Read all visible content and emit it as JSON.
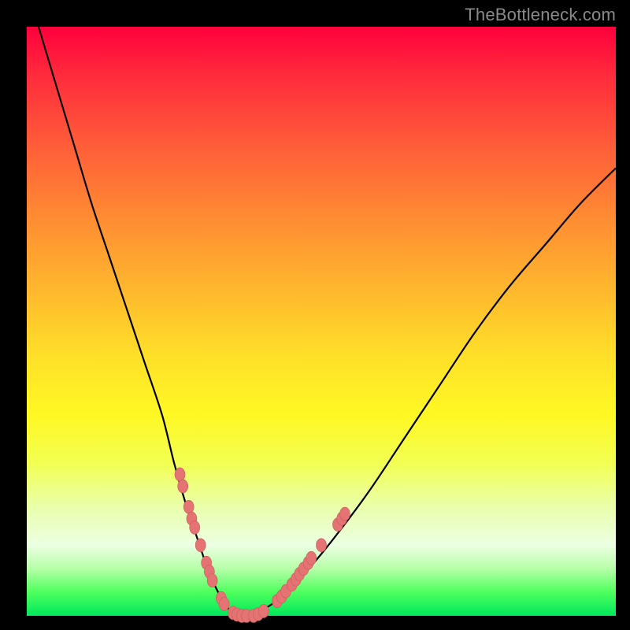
{
  "watermark": "TheBottleneck.com",
  "colors": {
    "background_frame": "#000000",
    "gradient_top": "#ff003c",
    "gradient_mid": "#ffe029",
    "gradient_bottom": "#00e85d",
    "curve_stroke": "#000000",
    "marker_fill": "#e57373",
    "marker_stroke": "#c45b5b"
  },
  "chart_data": {
    "type": "line",
    "title": "",
    "xlabel": "",
    "ylabel": "",
    "xlim": [
      0,
      100
    ],
    "ylim": [
      0,
      100
    ],
    "grid": false,
    "series": [
      {
        "name": "bottleneck-curve",
        "x": [
          2,
          5,
          8,
          11,
          14,
          17,
          20,
          23,
          25,
          27,
          29,
          30,
          31,
          32,
          33,
          34,
          35,
          36,
          38,
          40,
          43,
          47,
          52,
          58,
          64,
          70,
          76,
          82,
          88,
          94,
          100
        ],
        "values": [
          100,
          90,
          80,
          70,
          61,
          52,
          43,
          34,
          26,
          19,
          13,
          10,
          7,
          5,
          3,
          1.5,
          0.5,
          0,
          0,
          1,
          3,
          7,
          13,
          21,
          30,
          39,
          48,
          56,
          63,
          70,
          76
        ]
      }
    ],
    "markers": [
      {
        "x": 26.0,
        "y": 24.0
      },
      {
        "x": 26.5,
        "y": 22.0
      },
      {
        "x": 27.5,
        "y": 18.5
      },
      {
        "x": 28.0,
        "y": 16.5
      },
      {
        "x": 28.5,
        "y": 15.0
      },
      {
        "x": 29.5,
        "y": 12.0
      },
      {
        "x": 30.5,
        "y": 9.0
      },
      {
        "x": 31.0,
        "y": 7.5
      },
      {
        "x": 31.5,
        "y": 6.0
      },
      {
        "x": 33.0,
        "y": 3.0
      },
      {
        "x": 33.5,
        "y": 2.0
      },
      {
        "x": 35.0,
        "y": 0.5
      },
      {
        "x": 35.7,
        "y": 0.2
      },
      {
        "x": 36.5,
        "y": 0.0
      },
      {
        "x": 37.3,
        "y": 0.0
      },
      {
        "x": 38.5,
        "y": 0.0
      },
      {
        "x": 39.3,
        "y": 0.3
      },
      {
        "x": 40.2,
        "y": 0.8
      },
      {
        "x": 42.5,
        "y": 2.5
      },
      {
        "x": 43.3,
        "y": 3.3
      },
      {
        "x": 44.0,
        "y": 4.2
      },
      {
        "x": 45.0,
        "y": 5.3
      },
      {
        "x": 45.7,
        "y": 6.2
      },
      {
        "x": 46.3,
        "y": 7.1
      },
      {
        "x": 47.0,
        "y": 8.0
      },
      {
        "x": 47.8,
        "y": 9.0
      },
      {
        "x": 48.3,
        "y": 9.8
      },
      {
        "x": 50.0,
        "y": 12.0
      },
      {
        "x": 52.8,
        "y": 15.5
      },
      {
        "x": 53.5,
        "y": 16.5
      },
      {
        "x": 54.0,
        "y": 17.3
      }
    ]
  }
}
